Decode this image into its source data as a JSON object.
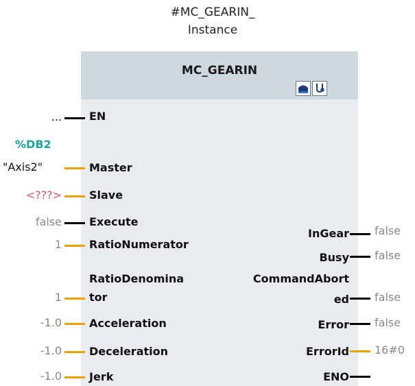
{
  "instance": {
    "line1": "#MC_GEARIN_",
    "line2": "Instance"
  },
  "block": {
    "title": "MC_GEARIN"
  },
  "toolbar": {
    "buttons": [
      "upload-icon",
      "diagnostics-icon"
    ]
  },
  "inputs": [
    {
      "label": "EN",
      "value": "..."
    },
    {
      "label": "Master",
      "db": "%DB2",
      "value": "\"Axis2\""
    },
    {
      "label": "Slave",
      "value": "<???>"
    },
    {
      "label": "Execute",
      "value": "false"
    },
    {
      "label": "RatioNumerator",
      "value": "1"
    },
    {
      "label1": "RatioDenomina",
      "label2": "tor",
      "value": "1"
    },
    {
      "label": "Acceleration",
      "value": "-1.0"
    },
    {
      "label": "Deceleration",
      "value": "-1.0"
    },
    {
      "label": "Jerk",
      "value": "-1.0"
    }
  ],
  "outputs": [
    {
      "label": "InGear",
      "value": "false"
    },
    {
      "label": "Busy",
      "value": "false"
    },
    {
      "label1": "CommandAbort",
      "label2": "ed",
      "value": "false"
    },
    {
      "label": "Error",
      "value": "false"
    },
    {
      "label": "ErrorId",
      "value": "16#0"
    },
    {
      "label": "ENO",
      "value": ""
    }
  ],
  "colors": {
    "bool_line": "#000000",
    "data_line": "#f0a000",
    "db_ref": "#1aa6a6",
    "invalid": "#e05070"
  }
}
